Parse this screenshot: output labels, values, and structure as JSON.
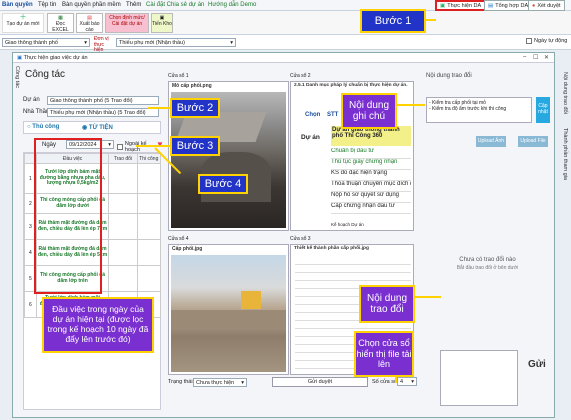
{
  "menu": {
    "items": [
      "Bàn quyền",
      "Tệp tin",
      "Bàn quyền phần mềm",
      "Thêm",
      "Cài đặt Chia sẻ dự án",
      "Hướng dẫn Demo"
    ],
    "top_buttons": [
      "Thực hiện DA",
      "Tổng hợp DA",
      "Xét duyệt"
    ]
  },
  "ribbon": {
    "items": [
      "Tạo dự án mới",
      "Đọc EXCEL",
      "Xuất báo cáo",
      "Chọn định mức/ Cài đặt dự án",
      "Tiến Kho"
    ]
  },
  "filter": {
    "project": "Giao thông thành phố",
    "unit_label": "Đơn vị thực hiện",
    "contractor": "Thiếu phụ mới (Nhận thầu)",
    "date_label": "Ngày tự động"
  },
  "window": {
    "title": "Thực hiện giao việc dự án",
    "side_tab": "Công tác",
    "right_tabs": [
      "Nội dung trao đổi",
      "Thành phần tham gia"
    ]
  },
  "left": {
    "heading": "Công tác",
    "project_label": "Dự án",
    "project_value": "Giao thông thành phố (5 Trao đổi)",
    "contractor_label": "Nhà Thầu",
    "contractor_value": "Thiếu phụ mới (Nhận thầu) (5 Trao đổi)",
    "radio_a": "Thủ công",
    "radio_b": "TỪ TIỆN",
    "day_label": "Ngày",
    "day_value": "09/12/2024",
    "plan_label": "Ngoài kế hoạch",
    "col_work": "Đầu việc",
    "col_code": "Trao đổi",
    "col_extra": "Thi công",
    "tasks": [
      {
        "no": "1",
        "text": "Tưới lớp dính bám mặt đường bằng nhựa pha dầu, lượng nhựa 0,5kg/m2"
      },
      {
        "no": "2",
        "text": "Thi công móng cấp phối đá dăm lớp dưới"
      },
      {
        "no": "3",
        "text": "Rải thảm mặt đường đá dăm đen, chiều dày đã lèn ép 7cm"
      },
      {
        "no": "4",
        "text": "Rải thảm mặt đường đá dăm đen, chiều dày đã lèn ép 5cm"
      },
      {
        "no": "5",
        "text": "Thi công móng cấp phối đá dăm lớp trên"
      },
      {
        "no": "6",
        "text": "Tưới lớp dính bám mặt đường bằng nhựa pha dầu, lượng nhựa 1kg/m2"
      }
    ]
  },
  "views": {
    "v1_label": "Cửa sổ 1",
    "v1_file": "Mô cấp phối.png",
    "v2_label": "Cửa sổ 2",
    "v2_file": "2.5.1 Danh mục pháp lý chuẩn bị thực hiện dự án.",
    "v2_col_a": "Chọn",
    "v2_col_b": "STT",
    "v2_row_a": "Dự án",
    "v2_row_a_text": "Dự án giao thông thành phố Thi Công 360",
    "v2_rows": [
      "Chuẩn bị đầu tư",
      "Thủ tục giấy chứng nhận",
      "KS đo đạc hiện trạng",
      "Thỏa thuận chuyển mục đích dụng đất",
      "Nộp hồ sơ quyết sử dụng",
      "Cấp chứng nhận đầu tư"
    ],
    "v2_footer": "Kế hoạch Dự án",
    "v3_label": "Cửa sổ 4",
    "v3_file": "Cấp phối.jpg",
    "v4_label": "Cửa sổ 3",
    "v4_file": "Thiết kế thành phần cấp phối.jpg"
  },
  "right": {
    "heading": "Nội dung trao đổi",
    "notes": "- Kiểm tra cấp phối tại mỏ\n- Kiểm tra độ ẩm trước khi thi công",
    "update_button": "Cập nhật",
    "upload_image": "Upload Ảnh",
    "upload_file": "Upload File",
    "empty_title": "Chưa có trao đổi nào",
    "empty_sub": "Bắt đầu trao đổi ở bên dưới",
    "send_button": "Gửi"
  },
  "bottom": {
    "status_label": "Trạng thái",
    "status_value": "Chưa thực hiện",
    "approve_button": "Gửi duyệt",
    "window_count_label": "Số cửa sổ",
    "window_count_value": "4"
  },
  "annotations": {
    "step1": "Bước 1",
    "step2": "Bước 2",
    "step3": "Bước 3",
    "step4": "Bước 4",
    "note_content": "Nội dung ghi chú",
    "exchange_content": "Nội dung trao đổi",
    "choose_windows": "Chọn cửa sổ hiển thị file tải lên",
    "task_explain": "Đầu việc trong ngày của dự án hiện tại (được lọc trong kế hoạch 10 ngày đã đẩy lên trước đó)"
  },
  "colors": {
    "annotation_purple": "#7a2fd0",
    "annotation_blue": "#2233c8",
    "highlight": "#ffd200",
    "task_green": "#1a7a2a",
    "red_outline": "#e02020"
  }
}
